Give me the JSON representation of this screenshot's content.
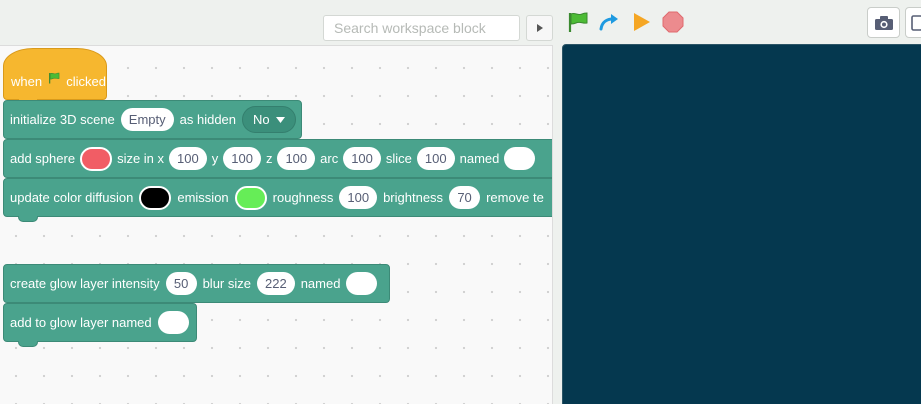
{
  "toolbar": {
    "search_placeholder": "Search workspace block",
    "search_icon": "play-triangle-icon",
    "run_icons": [
      "green-flag-icon",
      "redo-arrow-icon",
      "run-triangle-icon",
      "stop-octagon-icon"
    ],
    "camera_icon": "camera-icon",
    "layout_icon": "stage-layout-icon"
  },
  "colors": {
    "hat_block": "#f6b72f",
    "block": "#4aa38d",
    "stage": "#05384f",
    "sphere_color": "#f15d65",
    "diffusion_color": "#000000",
    "emission_color": "#66ed57"
  },
  "blocks": {
    "hat": {
      "when": "when",
      "flag_icon": "green-flag-icon",
      "clicked": "clicked"
    },
    "init_scene": {
      "label": "initialize 3D scene",
      "scene_value": "Empty",
      "hidden_label": "as hidden",
      "hidden_value": "No"
    },
    "add_sphere": {
      "label": "add sphere",
      "size_x_label": "size in x",
      "size_x": "100",
      "y_label": "y",
      "y": "100",
      "z_label": "z",
      "z": "100",
      "arc_label": "arc",
      "arc": "100",
      "slice_label": "slice",
      "slice": "100",
      "named_label": "named",
      "named": ""
    },
    "update_color": {
      "label": "update color diffusion",
      "emission_label": "emission",
      "roughness_label": "roughness",
      "roughness": "100",
      "brightness_label": "brightness",
      "brightness": "70",
      "remove_label": "remove te"
    },
    "glow_layer": {
      "label": "create glow layer intensity",
      "intensity": "50",
      "blur_label": "blur size",
      "blur": "222",
      "named_label": "named",
      "named": ""
    },
    "add_glow": {
      "label": "add to glow layer named",
      "named": ""
    }
  }
}
